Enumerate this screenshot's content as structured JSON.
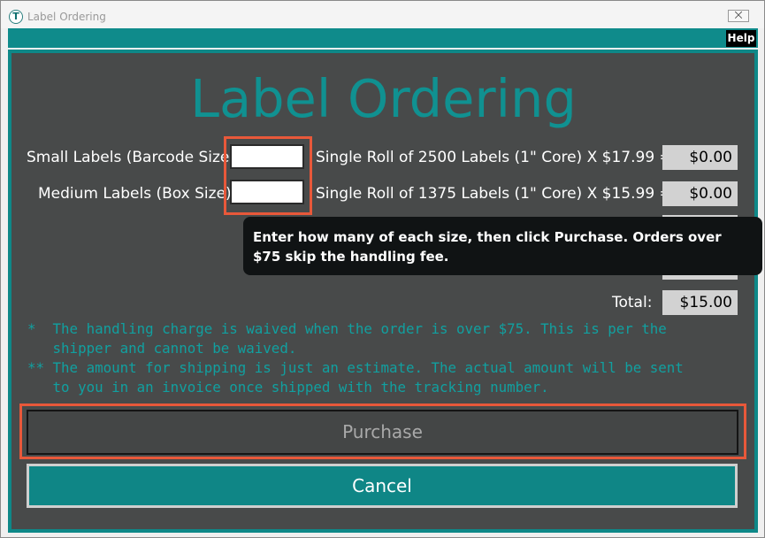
{
  "window": {
    "title": "Label Ordering",
    "close_glyph": "⨉",
    "icon_letter": "T"
  },
  "toolbar": {
    "help_label": "Help"
  },
  "form": {
    "heading": "Label Ordering",
    "rows": [
      {
        "label": "Small Labels (Barcode Size):",
        "value": "",
        "description": "Single Roll of 2500 Labels (1\" Core) X $17.99 =",
        "amount": "$0.00"
      },
      {
        "label": "Medium Labels (Box Size):",
        "value": "",
        "description": "Single Roll of 1375 Labels (1\" Core) X $15.99 =",
        "amount": "$0.00"
      }
    ],
    "total_label": "Total:",
    "total_amount": "$15.00"
  },
  "tooltip": {
    "text": "Enter how many of each size, then click Purchase. Orders over $75 skip the handling fee."
  },
  "notes": [
    "*  The handling charge is waived when the order is over $75. This is per the\n   shipper and cannot be waived.",
    "** The amount for shipping is just an estimate. The actual amount will be sent\n   to you in an invoice once shipped with the tracking number."
  ],
  "buttons": {
    "purchase": "Purchase",
    "cancel": "Cancel"
  },
  "colors": {
    "accent": "#0f8b8b",
    "panel": "#484a4a",
    "highlight": "#e8583a",
    "tooltip_bg": "#101314"
  }
}
